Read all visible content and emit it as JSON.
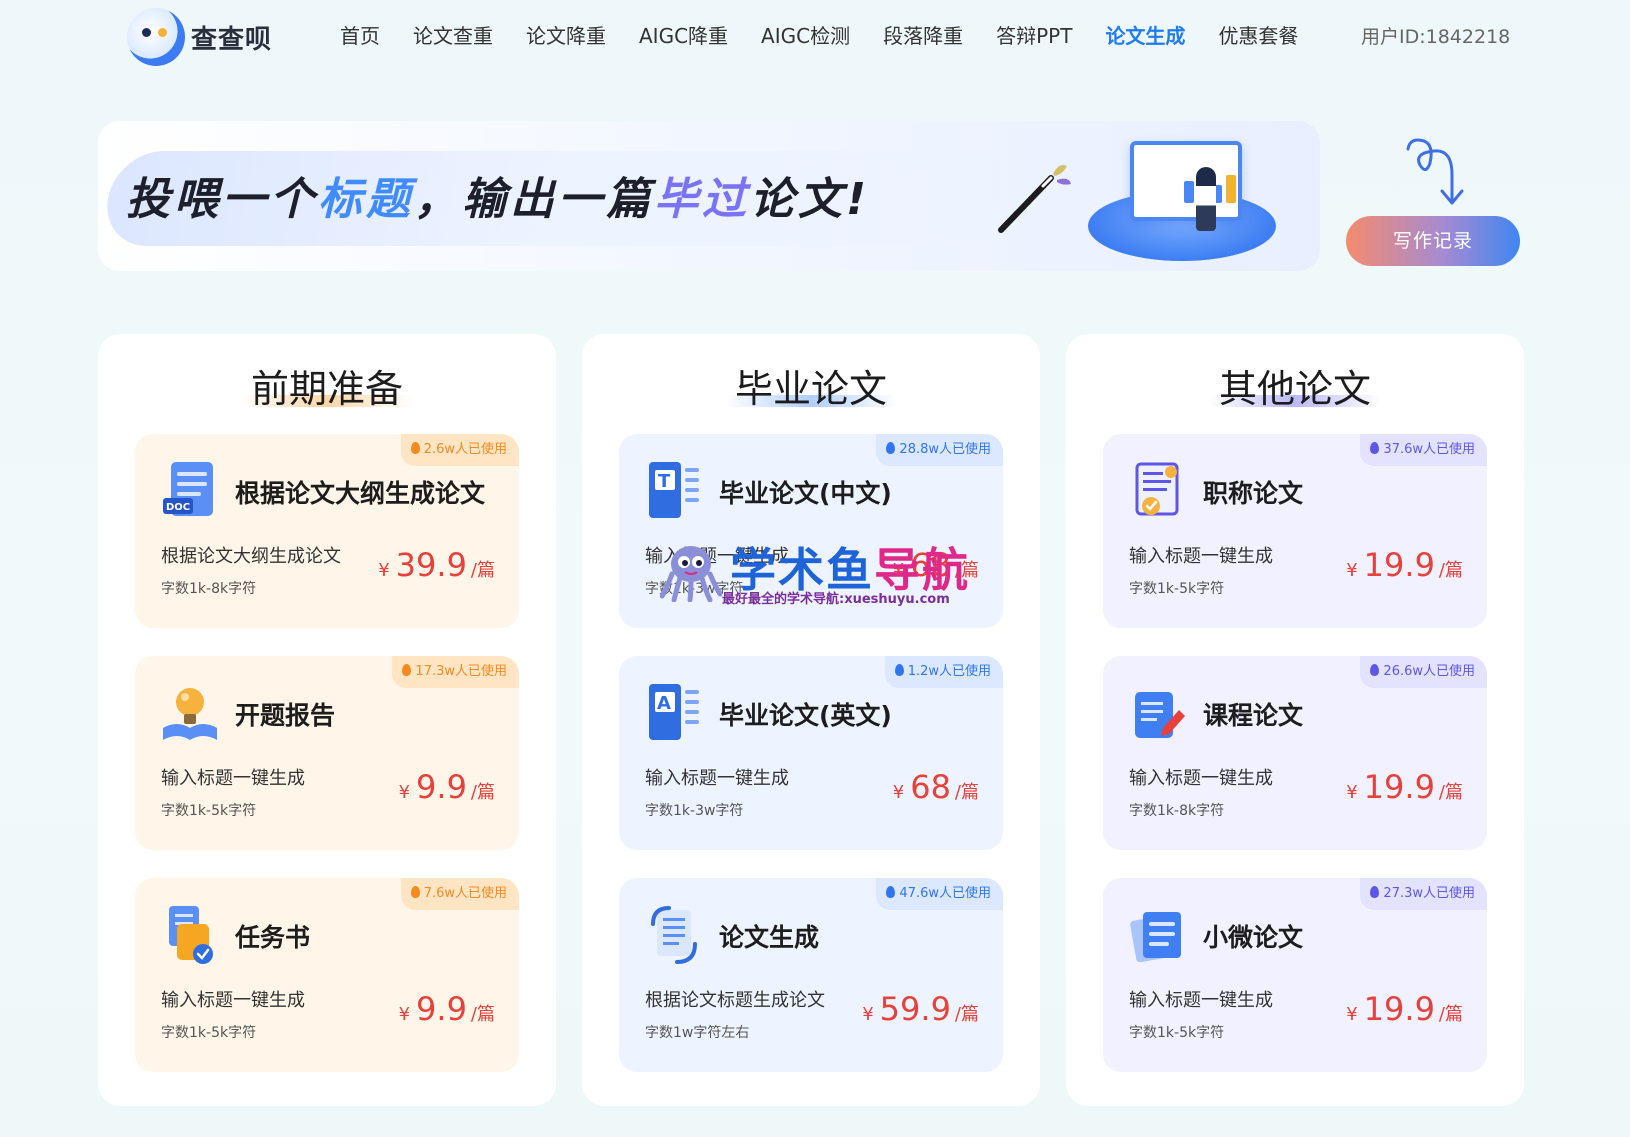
{
  "header": {
    "logo_text": "查查呗",
    "nav": [
      "首页",
      "论文查重",
      "论文降重",
      "AIGC降重",
      "AIGC检测",
      "段落降重",
      "答辩PPT",
      "论文生成",
      "优惠套餐"
    ],
    "active_index": 7,
    "user_id": "用户ID:1842218"
  },
  "banner": {
    "slogan_part1": "投喂一个",
    "slogan_hl1": "标题",
    "slogan_part2": "，输出一篇",
    "slogan_hl2": "毕过",
    "slogan_part3": "论文!",
    "record_button": "写作记录"
  },
  "columns": [
    {
      "title": "前期准备",
      "theme": "orange",
      "cards": [
        {
          "usage": "2.6w人已使用",
          "title": "根据论文大纲生成论文",
          "desc": "根据论文大纲生成论文",
          "words": "字数1k-8k字符",
          "currency": "¥",
          "price": "39.9",
          "unit": "/篇",
          "icon": "doc-file-icon"
        },
        {
          "usage": "17.3w人已使用",
          "title": "开题报告",
          "desc": "输入标题一键生成",
          "words": "字数1k-5k字符",
          "currency": "¥",
          "price": "9.9",
          "unit": "/篇",
          "icon": "lightbulb-book-icon"
        },
        {
          "usage": "7.6w人已使用",
          "title": "任务书",
          "desc": "输入标题一键生成",
          "words": "字数1k-5k字符",
          "currency": "¥",
          "price": "9.9",
          "unit": "/篇",
          "icon": "task-folder-icon"
        }
      ]
    },
    {
      "title": "毕业论文",
      "theme": "blue",
      "cards": [
        {
          "usage": "28.8w人已使用",
          "title": "毕业论文(中文)",
          "desc": "输入标题一键生成",
          "words": "字数1k-3w字符",
          "currency": "¥",
          "price": "68",
          "unit": "/篇",
          "icon": "text-doc-icon"
        },
        {
          "usage": "1.2w人已使用",
          "title": "毕业论文(英文)",
          "desc": "输入标题一键生成",
          "words": "字数1k-3w字符",
          "currency": "¥",
          "price": "68",
          "unit": "/篇",
          "icon": "english-doc-icon"
        },
        {
          "usage": "47.6w人已使用",
          "title": "论文生成",
          "desc": "根据论文标题生成论文",
          "words": "字数1w字符左右",
          "currency": "¥",
          "price": "59.9",
          "unit": "/篇",
          "icon": "refresh-doc-icon"
        }
      ]
    },
    {
      "title": "其他论文",
      "theme": "purple",
      "cards": [
        {
          "usage": "37.6w人已使用",
          "title": "职称论文",
          "desc": "输入标题一键生成",
          "words": "字数1k-5k字符",
          "currency": "¥",
          "price": "19.9",
          "unit": "/篇",
          "icon": "certificate-icon"
        },
        {
          "usage": "26.6w人已使用",
          "title": "课程论文",
          "desc": "输入标题一键生成",
          "words": "字数1k-8k字符",
          "currency": "¥",
          "price": "19.9",
          "unit": "/篇",
          "icon": "edit-doc-icon"
        },
        {
          "usage": "27.3w人已使用",
          "title": "小微论文",
          "desc": "输入标题一键生成",
          "words": "字数1k-5k字符",
          "currency": "¥",
          "price": "19.9",
          "unit": "/篇",
          "icon": "stacked-docs-icon"
        }
      ]
    }
  ],
  "watermark": {
    "text_a": "学术鱼",
    "text_b": "导航",
    "sub": "最好最全的学术导航:xueshuyu.com"
  },
  "colors": {
    "accent": "#1f7cf2",
    "price": "#e8413b",
    "orange": "#f58a1f",
    "blue": "#2f76ee",
    "purple": "#5e57e6"
  }
}
